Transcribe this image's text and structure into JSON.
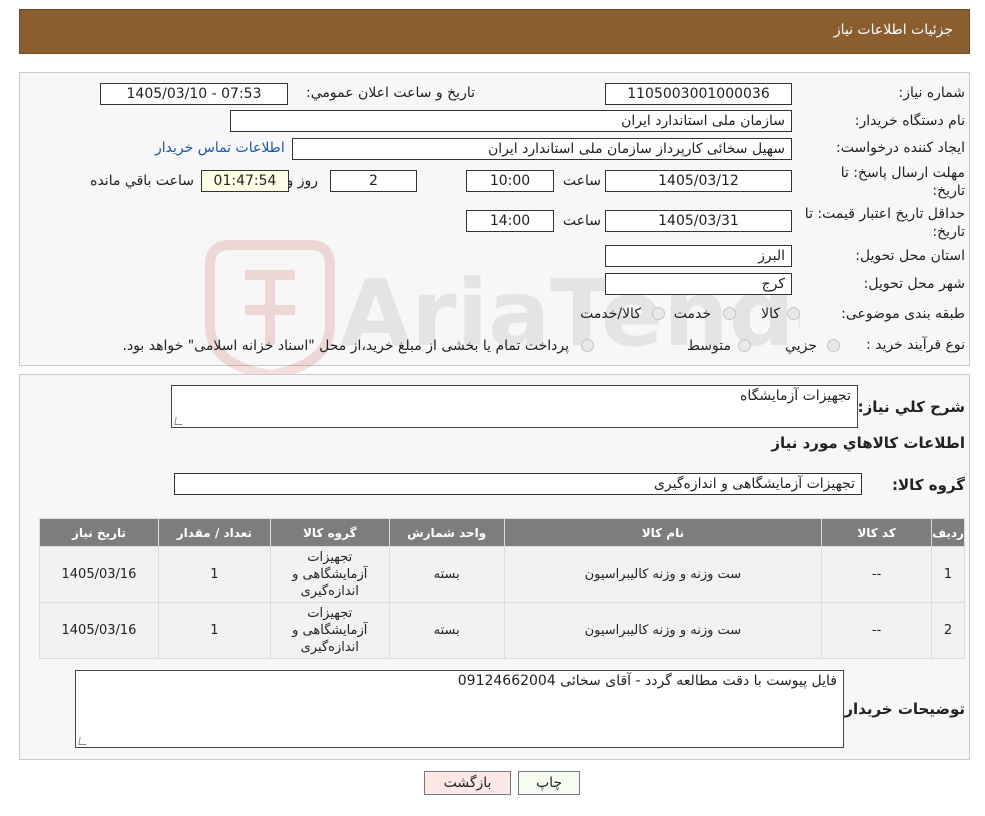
{
  "header": {
    "title": "جزئیات اطلاعات نیاز"
  },
  "form": {
    "need_number": {
      "label": "شماره نیاز:",
      "value": "1105003001000036"
    },
    "announce": {
      "label": "تاریخ و ساعت اعلان عمومي:",
      "value": "1405/03/10 - 07:53"
    },
    "buyer_org": {
      "label": "نام دستگاه خریدار:",
      "value": "سازمان ملی استاندارد ایران"
    },
    "creator": {
      "label": "ایجاد کننده درخواست:",
      "value": "سهیل سخائی کارپرداز سازمان ملی استاندارد ایران",
      "contact_link": "اطلاعات تماس خریدار"
    },
    "deadline": {
      "label_line1": "مهلت ارسال پاسخ: تا",
      "label_line2": "تاریخ:",
      "date": "1405/03/12",
      "time_label": "ساعت",
      "time": "10:00",
      "days": "2",
      "days_label": "روز و",
      "remaining": "01:47:54",
      "remaining_label": "ساعت باقي مانده"
    },
    "price_validity": {
      "label_line1": "حداقل تاریخ اعتبار قیمت: تا",
      "label_line2": "تاریخ:",
      "date": "1405/03/31",
      "time_label": "ساعت",
      "time": "14:00"
    },
    "province": {
      "label": "استان محل تحویل:",
      "value": "البرز"
    },
    "city": {
      "label": "شهر محل تحویل:",
      "value": "کرج"
    },
    "category": {
      "label": "طبقه بندی موضوعی:",
      "options": [
        "کالا",
        "خدمت",
        "کالا/خدمت"
      ]
    },
    "process": {
      "label": "نوع فرآیند خرید :",
      "options": [
        "جزیي",
        "متوسط"
      ],
      "note": "پرداخت تمام یا بخشی از مبلغ خرید،از محل \"اسناد خزانه اسلامی\" خواهد بود."
    }
  },
  "watermark": {
    "text": "AriaTender.neT"
  },
  "details": {
    "summary_label": "شرح کلي نیاز:",
    "summary_value": "تجهیزات آزمایشگاه",
    "goods_title": "اطلاعات کالاهاي مورد نیاز",
    "group_label": "گروه کالا:",
    "group_value": "تجهیزات آزمایشگاهی و اندازه‌گیری"
  },
  "table": {
    "headers": [
      "ردیف",
      "کد کالا",
      "نام کالا",
      "واحد شمارش",
      "گروه کالا",
      "تعداد / مقدار",
      "تاریخ نیاز"
    ],
    "rows": [
      {
        "row": "1",
        "code": "--",
        "name": "ست وزنه و وزنه کالیبراسیون",
        "unit": "بسته",
        "group_l1": "تجهیزات",
        "group_l2": "آزمایشگاهی و",
        "group_l3": "اندازه‌گیری",
        "qty": "1",
        "date": "1405/03/16"
      },
      {
        "row": "2",
        "code": "--",
        "name": "ست وزنه و وزنه کالیبراسیون",
        "unit": "بسته",
        "group_l1": "تجهیزات",
        "group_l2": "آزمایشگاهی و",
        "group_l3": "اندازه‌گیری",
        "qty": "1",
        "date": "1405/03/16"
      }
    ]
  },
  "buyer_notes": {
    "label": "توضیحات خریدار:",
    "value": "فایل پیوست با دقت مطالعه گردد - آقای سخائی 09124662004"
  },
  "buttons": {
    "print": "چاپ",
    "back": "بازگشت"
  }
}
